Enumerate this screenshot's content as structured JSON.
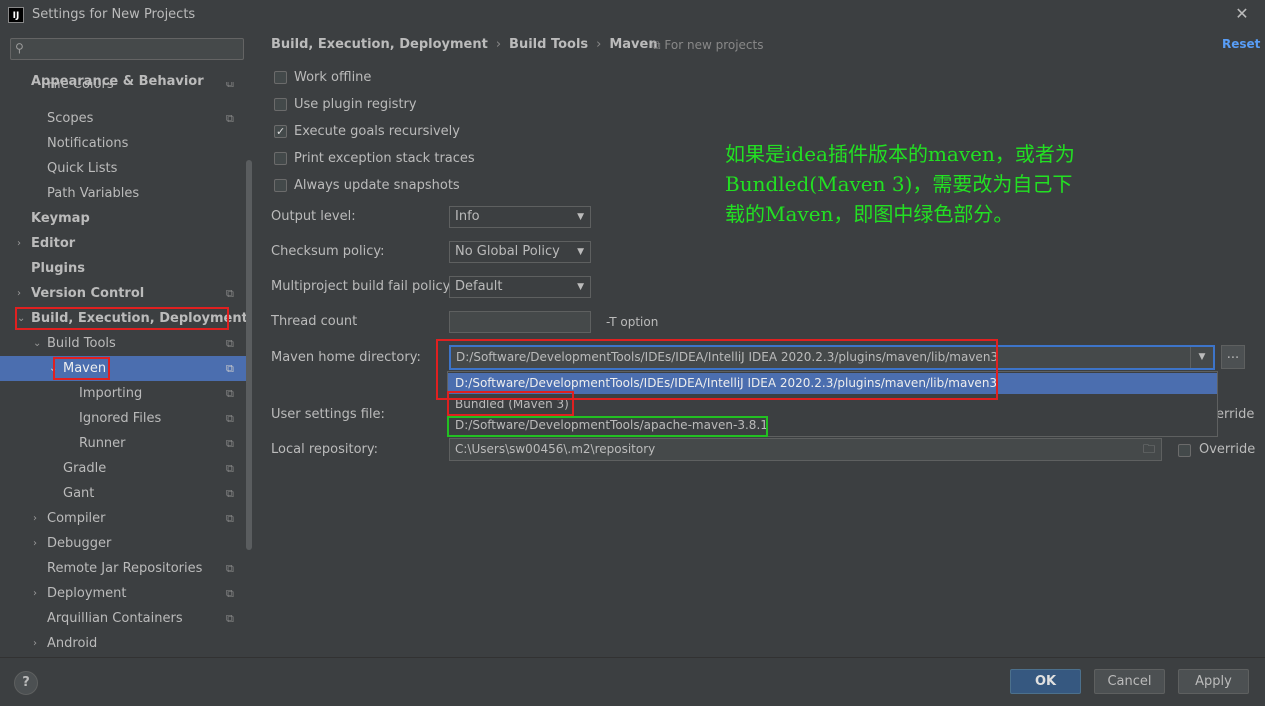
{
  "window": {
    "title": "Settings for New Projects",
    "logo": "IJ",
    "close": "✕"
  },
  "sidebar": {
    "search_placeholder": "",
    "items": [
      {
        "label": "Appearance & Behavior",
        "bold": true
      },
      {
        "label": "File Colors"
      },
      {
        "label": "Scopes"
      },
      {
        "label": "Notifications"
      },
      {
        "label": "Quick Lists"
      },
      {
        "label": "Path Variables"
      },
      {
        "label": "Keymap",
        "bold": true
      },
      {
        "label": "Editor",
        "bold": true
      },
      {
        "label": "Plugins",
        "bold": true
      },
      {
        "label": "Version Control",
        "bold": true
      },
      {
        "label": "Build, Execution, Deployment",
        "bold": true
      },
      {
        "label": "Build Tools"
      },
      {
        "label": "Maven"
      },
      {
        "label": "Importing"
      },
      {
        "label": "Ignored Files"
      },
      {
        "label": "Runner"
      },
      {
        "label": "Gradle"
      },
      {
        "label": "Gant"
      },
      {
        "label": "Compiler"
      },
      {
        "label": "Debugger"
      },
      {
        "label": "Remote Jar Repositories"
      },
      {
        "label": "Deployment"
      },
      {
        "label": "Arquillian Containers"
      },
      {
        "label": "Android"
      }
    ]
  },
  "breadcrumb": {
    "part1": "Build, Execution, Deployment",
    "sep": "›",
    "part2": "Build Tools",
    "part3": "Maven"
  },
  "for_new_projects": "For new projects",
  "reset": "Reset",
  "checkboxes": [
    {
      "label": "Work offline",
      "checked": false
    },
    {
      "label": "Use plugin registry",
      "checked": false
    },
    {
      "label": "Execute goals recursively",
      "checked": true
    },
    {
      "label": "Print exception stack traces",
      "checked": false
    },
    {
      "label": "Always update snapshots",
      "checked": false
    }
  ],
  "form": {
    "output_level_label": "Output level:",
    "output_level_value": "Info",
    "checksum_label": "Checksum policy:",
    "checksum_value": "No Global Policy",
    "multiproject_label": "Multiproject build fail policy:",
    "multiproject_value": "Default",
    "thread_label": "Thread count",
    "thread_value": "",
    "t_option": "-T option",
    "maven_home_label": "Maven home directory:",
    "maven_home_value": "D:/Software/DevelopmentTools/IDEs/IDEA/IntelliJ IDEA 2020.2.3/plugins/maven/lib/maven3",
    "browse": "...",
    "user_settings_label": "User settings file:",
    "override": "Override",
    "override_partial": "erride",
    "local_repo_label": "Local repository:",
    "local_repo_value": "C:\\Users\\sw00456\\.m2\\repository"
  },
  "dropdown_options": [
    "D:/Software/DevelopmentTools/IDEs/IDEA/IntelliJ IDEA 2020.2.3/plugins/maven/lib/maven3",
    "Bundled (Maven 3)",
    "D:/Software/DevelopmentTools/apache-maven-3.8.1"
  ],
  "annotation": {
    "line1": "如果是idea插件版本的maven，或者为",
    "line2": "Bundled(Maven 3)，需要改为自己下",
    "line3": "载的Maven，即图中绿色部分。"
  },
  "buttons": {
    "help": "?",
    "ok": "OK",
    "cancel": "Cancel",
    "apply": "Apply"
  },
  "colors": {
    "accent": "#4b6eaf",
    "annotation": "#22e022",
    "highlight_red": "#e02020",
    "highlight_green": "#22c022"
  }
}
